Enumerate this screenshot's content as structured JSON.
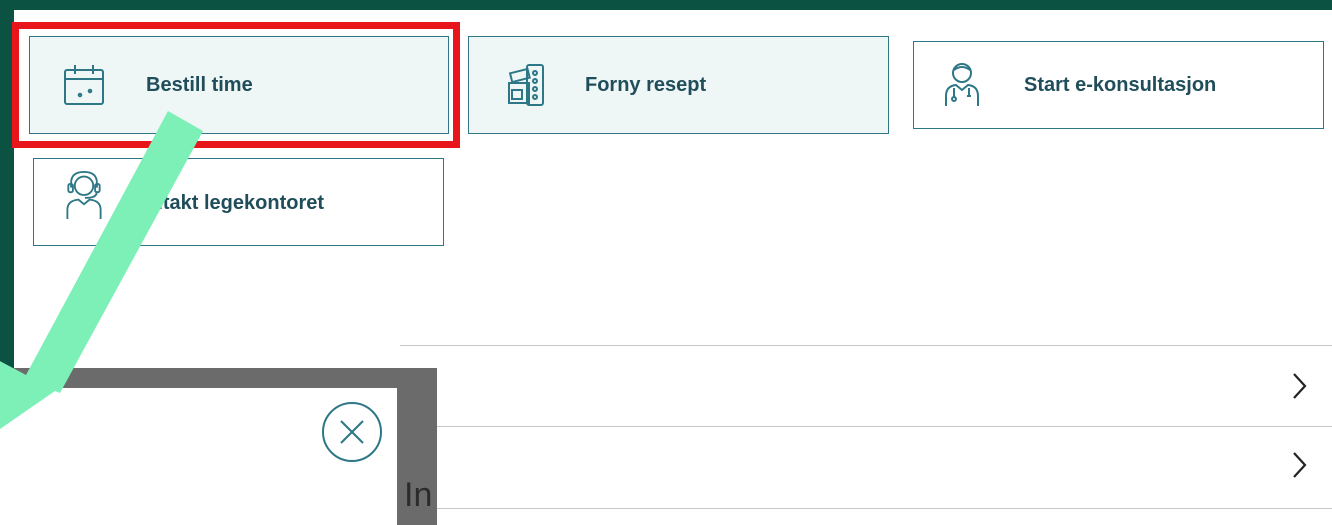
{
  "tiles": {
    "book": {
      "label": "Bestill time",
      "icon": "calendar-icon"
    },
    "renew": {
      "label": "Forny resept",
      "icon": "prescription-icon"
    },
    "consult": {
      "label": "Start e-konsultasjon",
      "icon": "doctor-icon"
    },
    "contact": {
      "label": "Kontakt legekontoret",
      "icon": "headset-icon"
    }
  },
  "modal": {
    "close_icon": "close-circle-icon",
    "peek_text": "In"
  },
  "colors": {
    "brand_green": "#0b5243",
    "tile_border": "#2d7787",
    "tile_bg": "#eef6f6",
    "label_text": "#1f4e5a",
    "highlight_red": "#e8161a",
    "annotation_arrow": "#7df0b8",
    "overlay_gray": "#6b6b6b"
  }
}
